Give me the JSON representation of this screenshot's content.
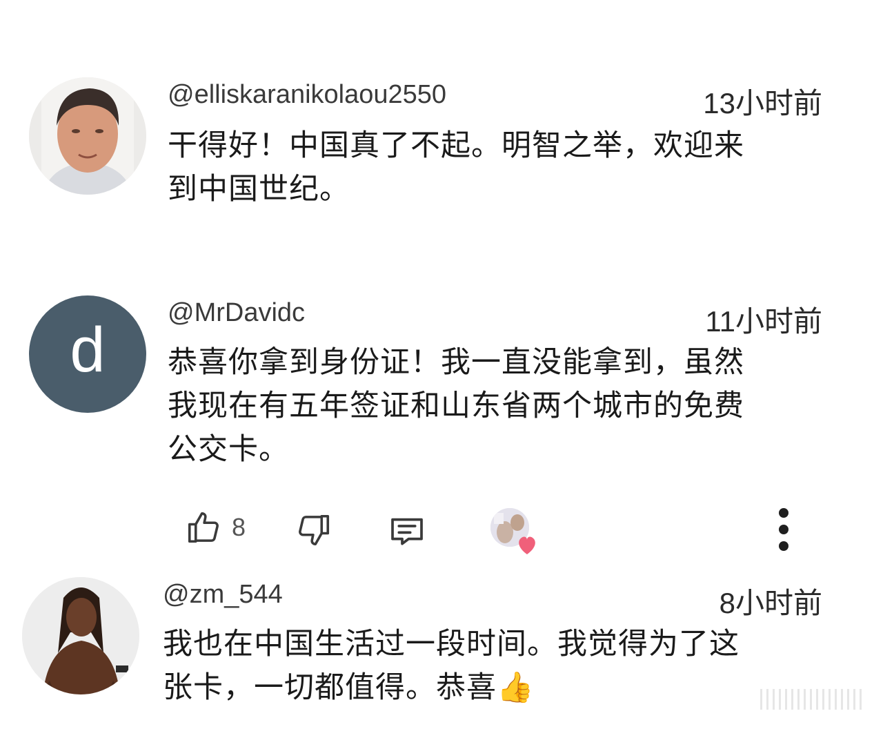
{
  "comments": [
    {
      "handle": "@elliskaranikolaou2550",
      "time": "13小时前",
      "lines": [
        "干得好！中国真了不起。明智之举，欢迎来",
        "到中国世纪。"
      ],
      "avatar": "photo-man"
    },
    {
      "handle": "@MrDavidc",
      "time": "11小时前",
      "lines": [
        "恭喜你拿到身份证！我一直没能拿到，虽然",
        "我现在有五年签证和山东省两个城市的免费",
        "公交卡。"
      ],
      "avatar_letter": "d",
      "avatar_color": "#4a5d6b",
      "actions": {
        "like_count": "8",
        "like_icon": "thumbs-up-icon",
        "dislike_icon": "thumbs-down-icon",
        "reply_icon": "reply-icon",
        "more_icon": "more-vertical-icon",
        "creator_heart_icon": "creator-heart-icon"
      }
    },
    {
      "handle": "@zm_544",
      "time": "8小时前",
      "lines": [
        "我也在中国生活过一段时间。我觉得为了这",
        "张卡，一切都值得。恭喜👍"
      ],
      "avatar": "game-character"
    }
  ],
  "colors": {
    "heart": "#f0607a",
    "text": "#1a1a1a",
    "icon": "#3a3a3a"
  }
}
